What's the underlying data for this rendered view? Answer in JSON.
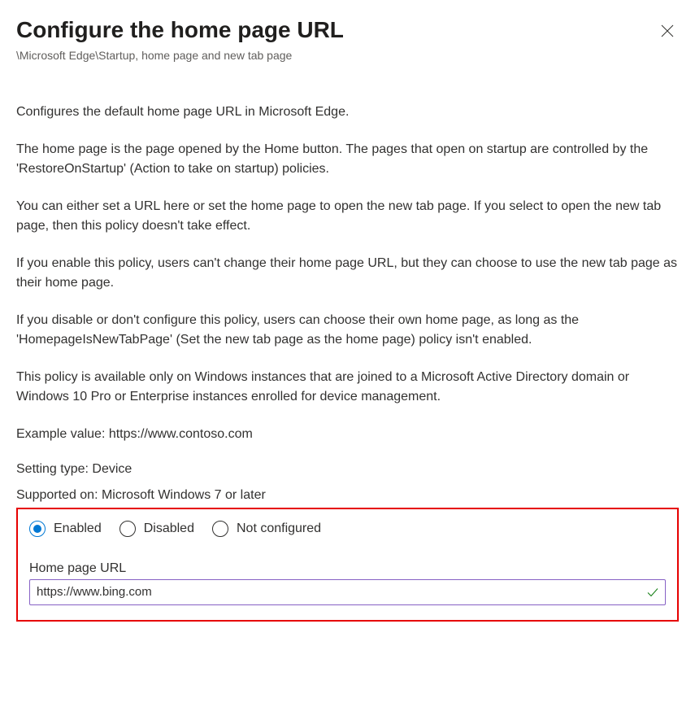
{
  "header": {
    "title": "Configure the home page URL",
    "breadcrumb": "\\Microsoft Edge\\Startup, home page and new tab page"
  },
  "description": {
    "p1": "Configures the default home page URL in Microsoft Edge.",
    "p2": "The home page is the page opened by the Home button. The pages that open on startup are controlled by the 'RestoreOnStartup' (Action to take on startup) policies.",
    "p3": "You can either set a URL here or set the home page to open the new tab page. If you select to open the new tab page, then this policy doesn't take effect.",
    "p4": "If you enable this policy, users can't change their home page URL, but they can choose to use the new tab page as their home page.",
    "p5": "If you disable or don't configure this policy, users can choose their own home page, as long as the 'HomepageIsNewTabPage' (Set the new tab page as the home page) policy isn't enabled.",
    "p6": "This policy is available only on Windows instances that are joined to a Microsoft Active Directory domain or Windows 10 Pro or Enterprise instances enrolled for device management.",
    "p7": "Example value: https://www.contoso.com"
  },
  "setting_type": "Setting type: Device",
  "supported_on": "Supported on: Microsoft Windows 7 or later",
  "radios": {
    "enabled": "Enabled",
    "disabled": "Disabled",
    "not_configured": "Not configured",
    "selected": "enabled"
  },
  "field": {
    "label": "Home page URL",
    "value": "https://www.bing.com"
  }
}
